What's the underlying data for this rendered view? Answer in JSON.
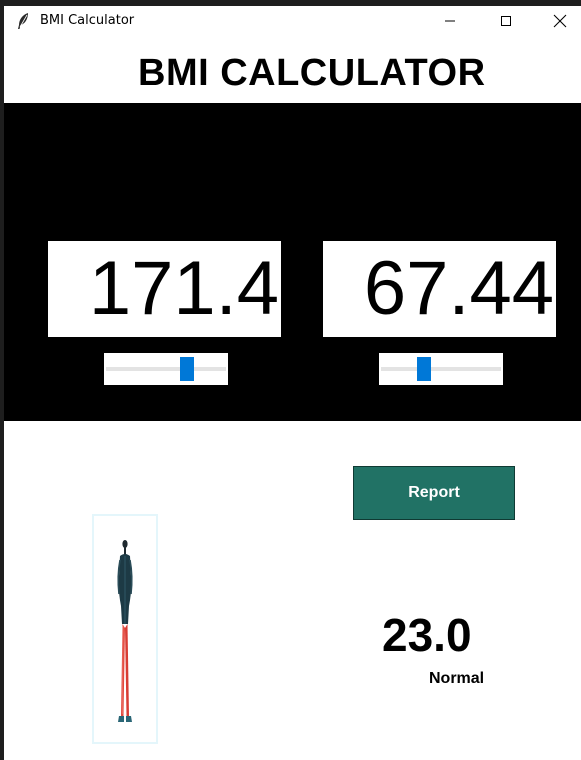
{
  "window": {
    "title": "BMI Calculator",
    "icon": "feather-icon"
  },
  "heading": "BMI CALCULATOR",
  "height": {
    "value": "171.4",
    "slider_fraction": 0.7
  },
  "weight": {
    "value": "67.44",
    "slider_fraction": 0.34
  },
  "report_button": {
    "label": "Report",
    "color": "#217265"
  },
  "result": {
    "bmi": "23.0",
    "category": "Normal"
  },
  "colors": {
    "slider_thumb": "#0078d7",
    "panel_background": "#000000"
  }
}
